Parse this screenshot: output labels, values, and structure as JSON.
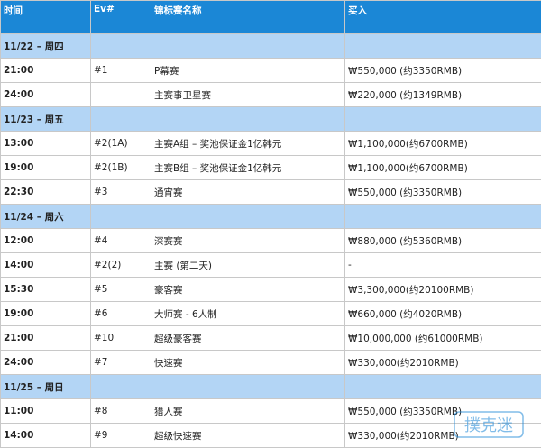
{
  "table": {
    "headers": [
      "时间",
      "Ev#",
      "锦标赛名称",
      "买入"
    ],
    "days": [
      {
        "date": "11/22 – 周四",
        "events": [
          {
            "time": "21:00",
            "ev": "#1",
            "name": "P幕赛",
            "buyin": "₩550,000 (约3350RMB)"
          },
          {
            "time": "24:00",
            "ev": "",
            "name": "主赛事卫星赛",
            "buyin": "₩220,000 (约1349RMB)"
          }
        ]
      },
      {
        "date": "11/23 – 周五",
        "events": [
          {
            "time": "13:00",
            "ev": "#2(1A)",
            "name": "主赛A组 – 奖池保证金1亿韩元",
            "buyin": "₩1,100,000(约6700RMB)"
          },
          {
            "time": "19:00",
            "ev": "#2(1B)",
            "name": "主赛B组 – 奖池保证金1亿韩元",
            "buyin": "₩1,100,000(约6700RMB)"
          },
          {
            "time": "22:30",
            "ev": "#3",
            "name": "通宵赛",
            "buyin": "₩550,000 (约3350RMB)"
          }
        ]
      },
      {
        "date": "11/24 – 周六",
        "events": [
          {
            "time": "12:00",
            "ev": "#4",
            "name": "深赛赛",
            "buyin": "₩880,000 (约5360RMB)"
          },
          {
            "time": "14:00",
            "ev": "#2(2)",
            "name": "主赛 (第二天)",
            "buyin": "-"
          },
          {
            "time": "15:30",
            "ev": "#5",
            "name": "豪客赛",
            "buyin": "₩3,300,000(约20100RMB)"
          },
          {
            "time": "19:00",
            "ev": "#6",
            "name": "大师赛 - 6人制",
            "buyin": "₩660,000 (约4020RMB)"
          },
          {
            "time": "21:00",
            "ev": "#10",
            "name": "超级豪客赛",
            "buyin": "₩10,000,000 (约61000RMB)"
          },
          {
            "time": "24:00",
            "ev": "#7",
            "name": "快速赛",
            "buyin": "₩330,000(约2010RMB)"
          }
        ]
      },
      {
        "date": "11/25 – 周日",
        "events": [
          {
            "time": "11:00",
            "ev": "#8",
            "name": "猎人赛",
            "buyin": "₩550,000 (约3350RMB)"
          },
          {
            "time": "14:00",
            "ev": "#9",
            "name": "超级快速赛",
            "buyin": "₩330,000(约2010RMB)"
          }
        ]
      }
    ]
  },
  "watermark": {
    "text": "撲克迷",
    "color": "#1b87d6"
  }
}
